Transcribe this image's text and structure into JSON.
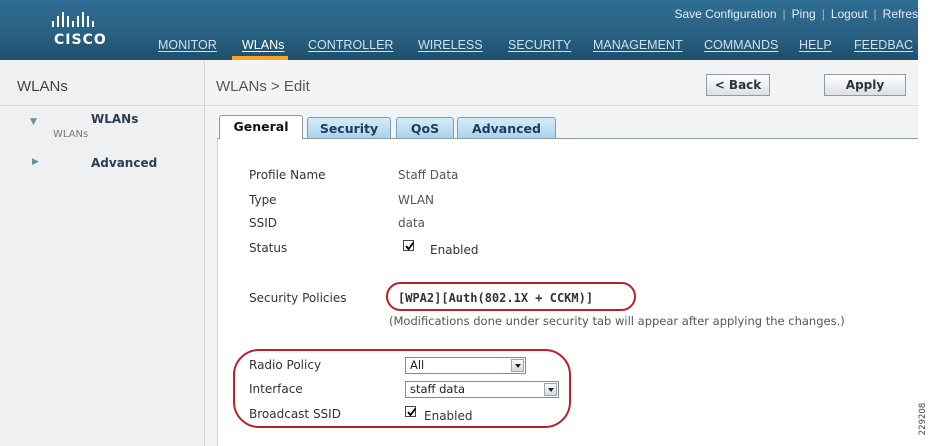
{
  "header": {
    "logo_text": "CISCO",
    "top_links": [
      "Save Configuration",
      "Ping",
      "Logout",
      "Refres"
    ],
    "nav": [
      "MONITOR",
      "WLANs",
      "CONTROLLER",
      "WIRELESS",
      "SECURITY",
      "MANAGEMENT",
      "COMMANDS",
      "HELP",
      "FEEDBAC"
    ],
    "active_nav": "WLANs",
    "accent_color": "#f6a623"
  },
  "sidebar": {
    "title": "WLANs",
    "items": [
      {
        "label": "WLANs",
        "sub": "WLANs",
        "icon": "triangle-down-icon"
      },
      {
        "label": "Advanced",
        "icon": "triangle-right-icon"
      }
    ]
  },
  "main": {
    "breadcrumb": "WLANs > Edit",
    "back_label": "< Back",
    "apply_label": "Apply",
    "tabs": [
      "General",
      "Security",
      "QoS",
      "Advanced"
    ],
    "active_tab": "General",
    "form": {
      "profile_name": {
        "label": "Profile Name",
        "value": "Staff Data"
      },
      "type": {
        "label": "Type",
        "value": "WLAN"
      },
      "ssid": {
        "label": "SSID",
        "value": "data"
      },
      "status": {
        "label": "Status",
        "checked": true,
        "text": "Enabled"
      },
      "security_policies": {
        "label": "Security Policies",
        "value": "[WPA2][Auth(802.1X + CCKM)]",
        "note": "(Modifications done under security tab will appear after applying the changes.)"
      },
      "radio_policy": {
        "label": "Radio Policy",
        "value": "All"
      },
      "interface": {
        "label": "Interface",
        "value": "staff data"
      },
      "broadcast_ssid": {
        "label": "Broadcast SSID",
        "checked": true,
        "text": "Enabled"
      }
    },
    "highlight_color": "#b8212b"
  },
  "figure_code": "229208"
}
